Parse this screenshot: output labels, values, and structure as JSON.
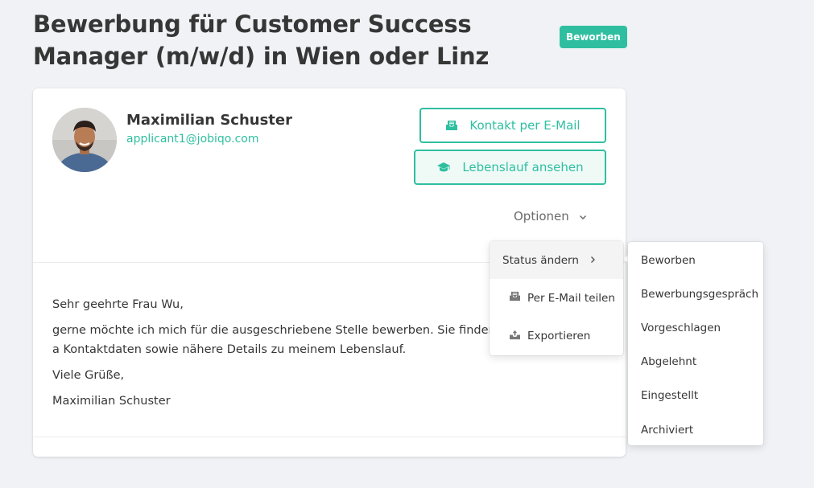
{
  "header": {
    "title": "Bewerbung für Customer Success Manager (m/w/d) in Wien oder Linz",
    "status_badge": "Beworben"
  },
  "applicant": {
    "name": "Maximilian Schuster",
    "email": "applicant1@jobiqo.com"
  },
  "actions": {
    "contact_email_label": "Kontakt per E-Mail",
    "view_cv_label": "Lebenslauf ansehen",
    "options_label": "Optionen"
  },
  "options_menu": {
    "change_status_label": "Status ändern",
    "share_email_label": "Per E-Mail teilen",
    "export_label": "Exportieren"
  },
  "status_menu": {
    "items": [
      "Beworben",
      "Bewerbungsgespräch",
      "Vorgeschlagen",
      "Abgelehnt",
      "Eingestellt",
      "Archiviert"
    ]
  },
  "letter": {
    "greeting": "Sehr geehrte Frau Wu,",
    "body": "gerne möchte ich mich für die ausgeschriebene Stelle bewerben. Sie finden a Kontaktdaten sowie nähere Details zu meinem Lebenslauf.",
    "closing": "Viele Grüße,",
    "signature": "Maximilian Schuster"
  },
  "colors": {
    "accent": "#2fbfa0",
    "background": "#f0f2f5",
    "text": "#363636"
  }
}
